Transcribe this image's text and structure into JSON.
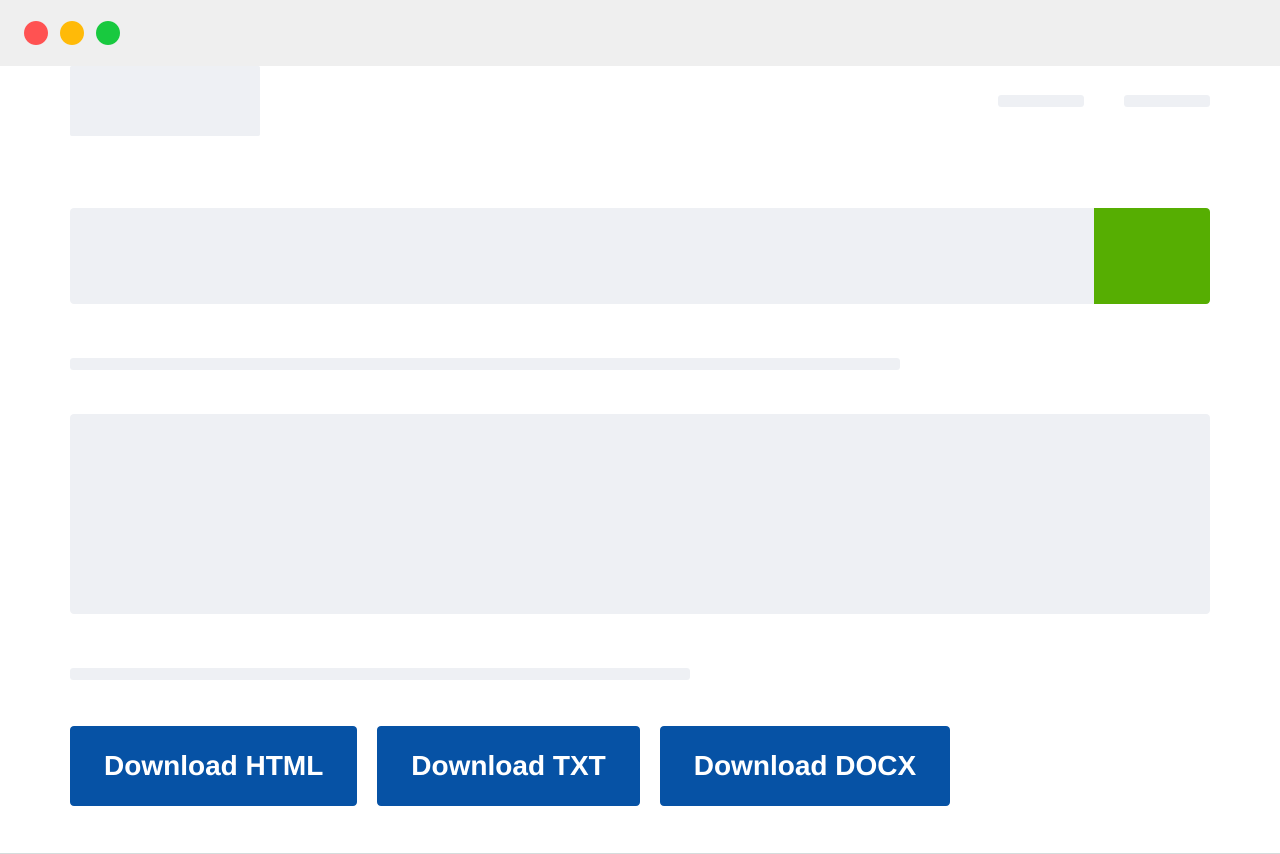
{
  "search": {
    "placeholder": "",
    "button_label": ""
  },
  "downloads": {
    "html": "Download HTML",
    "txt": "Download TXT",
    "docx": "Download DOCX"
  }
}
